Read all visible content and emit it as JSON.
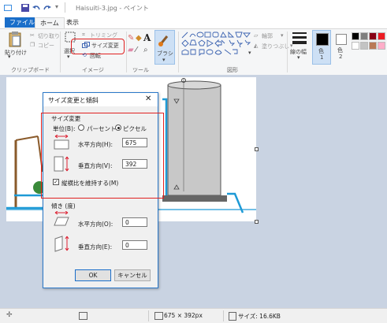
{
  "title_bar": {
    "title": "Haisuiti-3.jpg - ペイント"
  },
  "tabs": [
    {
      "label": "ファイル"
    },
    {
      "label": "ホーム"
    },
    {
      "label": "表示"
    }
  ],
  "clipboard": {
    "paste": "貼り付け",
    "cut": "切り取り",
    "copy": "コピー",
    "group": "クリップボード"
  },
  "image_group": {
    "select": "選択",
    "crop": "トリミング",
    "resize": "サイズ変更",
    "rotate": "回転",
    "group": "イメージ"
  },
  "tools": {
    "group": "ツール"
  },
  "brush": {
    "label": "ブラシ"
  },
  "shapes": {
    "outline": "輪郭",
    "fill": "塗りつぶし",
    "group": "図形"
  },
  "line_width": {
    "label": "線の幅"
  },
  "colors": {
    "color1": "色",
    "color1_num": "1",
    "color2": "色",
    "color2_num": "2",
    "palette": [
      "#000000",
      "#7f7f7f",
      "#880015",
      "#ed1c24",
      "#ffffff",
      "#c3c3c3",
      "#b97a57",
      "#ffaec9"
    ]
  },
  "dialog": {
    "title": "サイズ変更と傾斜",
    "resize_section": "サイズ変更",
    "unit_label": "単位(B):",
    "percent": "パーセント",
    "pixel": "ピクセル",
    "horizontal_label": "水平方向(H):",
    "horizontal_value": "675",
    "vertical_label": "垂直方向(V):",
    "vertical_value": "392",
    "keep_ratio": "縦横比を維持する(M)",
    "skew_section": "傾き (度)",
    "skew_h_label": "水平方向(O):",
    "skew_h_value": "0",
    "skew_v_label": "垂直方向(E):",
    "skew_v_value": "0",
    "ok": "OK",
    "cancel": "キャンセル"
  },
  "status": {
    "dimensions": "675 × 392px",
    "size": "サイズ: 16.6KB"
  }
}
